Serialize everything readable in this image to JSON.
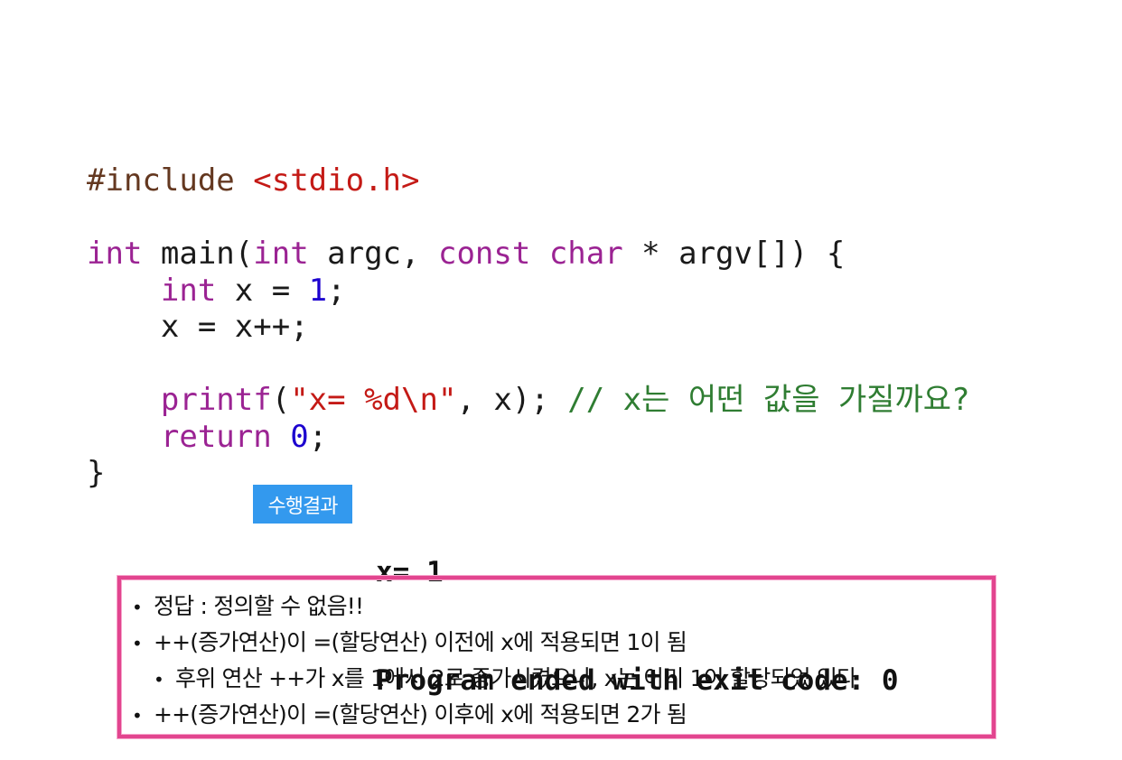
{
  "code": {
    "include_directive": "#include",
    "include_header": "<stdio.h>",
    "line_main": {
      "kw_int": "int",
      "name": " main(",
      "kw_int2": "int",
      "args1": " argc, ",
      "kw_const": "const",
      "sp": " ",
      "kw_char": "char",
      "args2": " * argv[]) {"
    },
    "line_decl": {
      "indent": "    ",
      "kw": "int",
      "mid": " x = ",
      "num": "1",
      "end": ";"
    },
    "line_assign": "    x = x++;",
    "line_printf": {
      "indent": "    ",
      "fn": "printf",
      "open": "(",
      "str": "\"x= %d\\n\"",
      "rest": ", x); ",
      "comment": "// x는 어떤 값을 가질까요?"
    },
    "line_return": {
      "indent": "    ",
      "kw": "return",
      "sp": " ",
      "num": "0",
      "end": ";"
    },
    "line_close": "}"
  },
  "result_badge": "수행결과",
  "output": {
    "line1": "x= 1",
    "line2": "Program ended with exit code: 0"
  },
  "answers": [
    {
      "bullet": "•",
      "text": "정답 :  정의할 수 없음!!",
      "sub": false
    },
    {
      "bullet": "•",
      "text": "++(증가연산)이 =(할당연산) 이전에 x에 적용되면 1이 됨",
      "sub": false
    },
    {
      "bullet": "•",
      "text": "후위 연산 ++가 x를 1에서 2로 증가시켰으나, x는 이미 1이 할당되었 있다",
      "sub": true
    },
    {
      "bullet": "•",
      "text": "++(증가연산)이 =(할당연산) 이후에 x에 적용되면 2가 됨",
      "sub": false
    }
  ],
  "colors": {
    "badge": "#3399ee",
    "box_border": "#e2458f",
    "keyword": "#9b2393",
    "string": "#c41a16",
    "number": "#1c00cf",
    "comment": "#2f7d32"
  }
}
